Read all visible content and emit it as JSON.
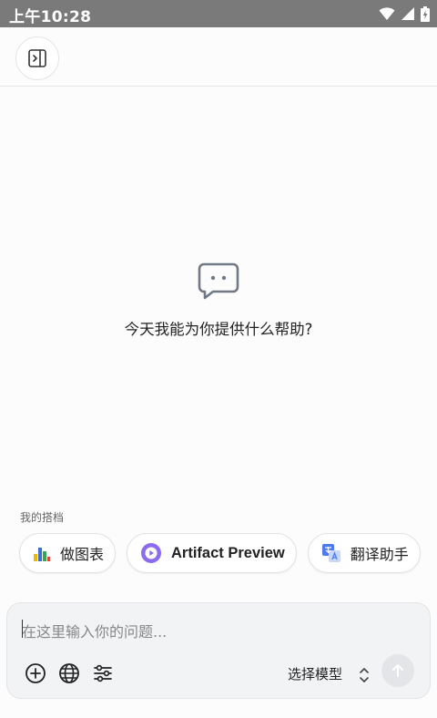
{
  "status_bar": {
    "time": "上午10:28"
  },
  "header": {
    "panel_toggle": "sidebar-toggle-icon"
  },
  "empty_state": {
    "icon": "chat-bubble-icon",
    "text": "今天我能为你提供什么帮助?"
  },
  "partners": {
    "label": "我的搭档",
    "items": [
      {
        "label": "做图表",
        "icon": "bar-chart-icon"
      },
      {
        "label": "Artifact Preview",
        "icon": "play-circle-icon"
      },
      {
        "label": "翻译助手",
        "icon": "translate-icon"
      }
    ]
  },
  "composer": {
    "placeholder": "在这里输入你的问题...",
    "model_select": "选择模型",
    "tools": [
      "add-icon",
      "globe-icon",
      "sliders-icon"
    ]
  }
}
